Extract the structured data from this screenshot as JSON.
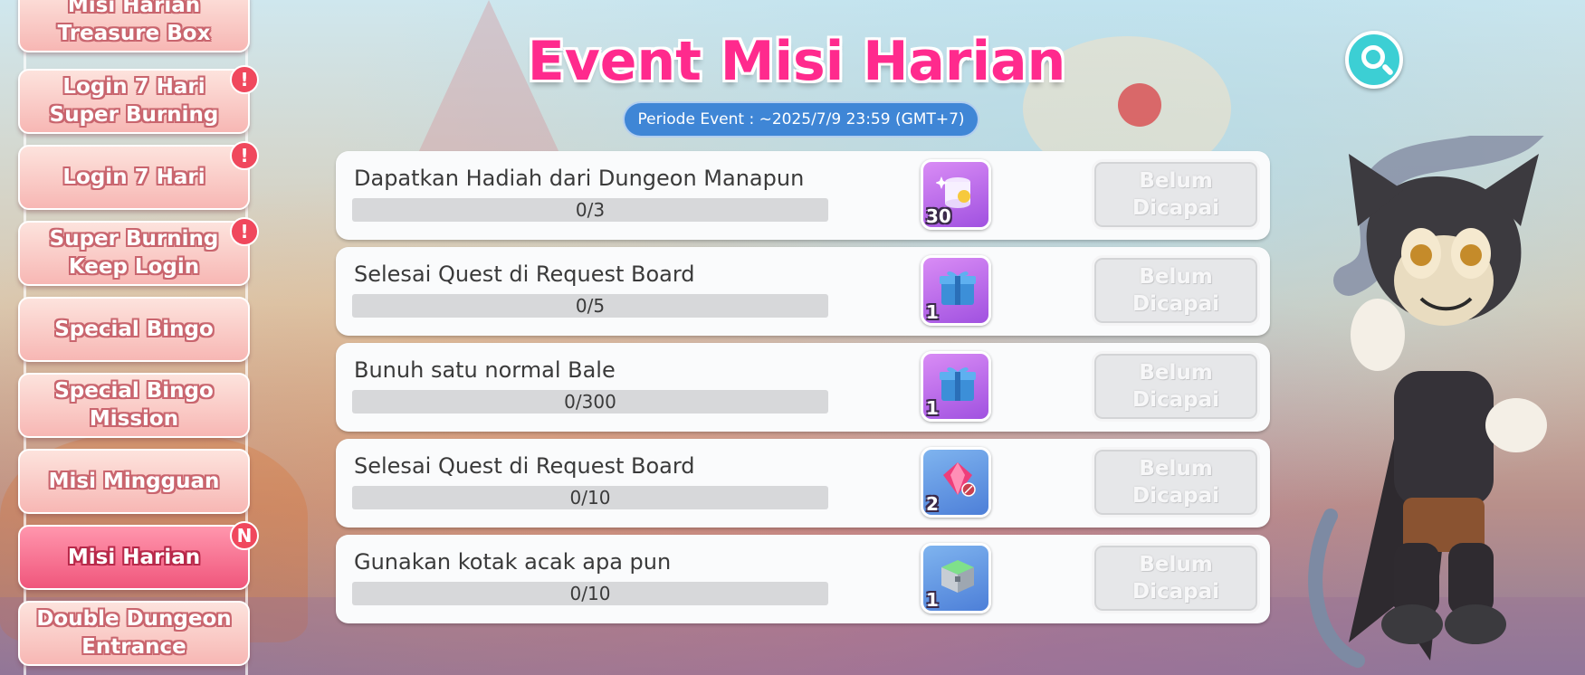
{
  "sidebar": {
    "items": [
      {
        "label": "Misi Harian\nTreasure Box",
        "badge": "",
        "active": false
      },
      {
        "label": "Login 7 Hari\nSuper Burning",
        "badge": "!",
        "active": false
      },
      {
        "label": "Login 7 Hari",
        "badge": "!",
        "active": false
      },
      {
        "label": "Super Burning\nKeep Login",
        "badge": "!",
        "active": false
      },
      {
        "label": "Special Bingo",
        "badge": "",
        "active": false
      },
      {
        "label": "Special Bingo\nMission",
        "badge": "",
        "active": false
      },
      {
        "label": "Misi Mingguan",
        "badge": "",
        "active": false
      },
      {
        "label": "Misi Harian",
        "badge": "N",
        "active": true
      },
      {
        "label": "Double Dungeon\nEntrance",
        "badge": "",
        "active": false
      }
    ]
  },
  "header": {
    "title": "Event Misi Harian",
    "period": "Periode Event : ~2025/7/9 23:59 (GMT+7)",
    "search_icon": "search-icon"
  },
  "missions": [
    {
      "title": "Dapatkan Hadiah dari Dungeon Manapun",
      "progress_text": "0/3",
      "progress": 0,
      "reward_count": "30",
      "reward_icon": "potion-jar-icon",
      "status": "Belum\nDicapai"
    },
    {
      "title": "Selesai Quest di Request Board",
      "progress_text": "0/5",
      "progress": 0,
      "reward_count": "1",
      "reward_icon": "blue-gift-box-icon",
      "status": "Belum\nDicapai"
    },
    {
      "title": "Bunuh satu normal Bale",
      "progress_text": "0/300",
      "progress": 0,
      "reward_count": "1",
      "reward_icon": "blue-gift-box-icon",
      "status": "Belum\nDicapai"
    },
    {
      "title": "Selesai Quest di Request Board",
      "progress_text": "0/10",
      "progress": 0,
      "reward_count": "2",
      "reward_icon": "pink-gem-icon",
      "status": "Belum\nDicapai"
    },
    {
      "title": "Gunakan kotak acak apa pun",
      "progress_text": "0/10",
      "progress": 0,
      "reward_count": "1",
      "reward_icon": "green-chest-icon",
      "status": "Belum\nDicapai"
    }
  ],
  "colors": {
    "title": "#ff2a8d",
    "period_pill": "#3f86d6",
    "tab_active": "#f0567c",
    "tab_inactive": "#f7b7b4",
    "badge": "#f0485d",
    "search_button": "#3ccfd4",
    "status_disabled": "#e6e7e9"
  }
}
